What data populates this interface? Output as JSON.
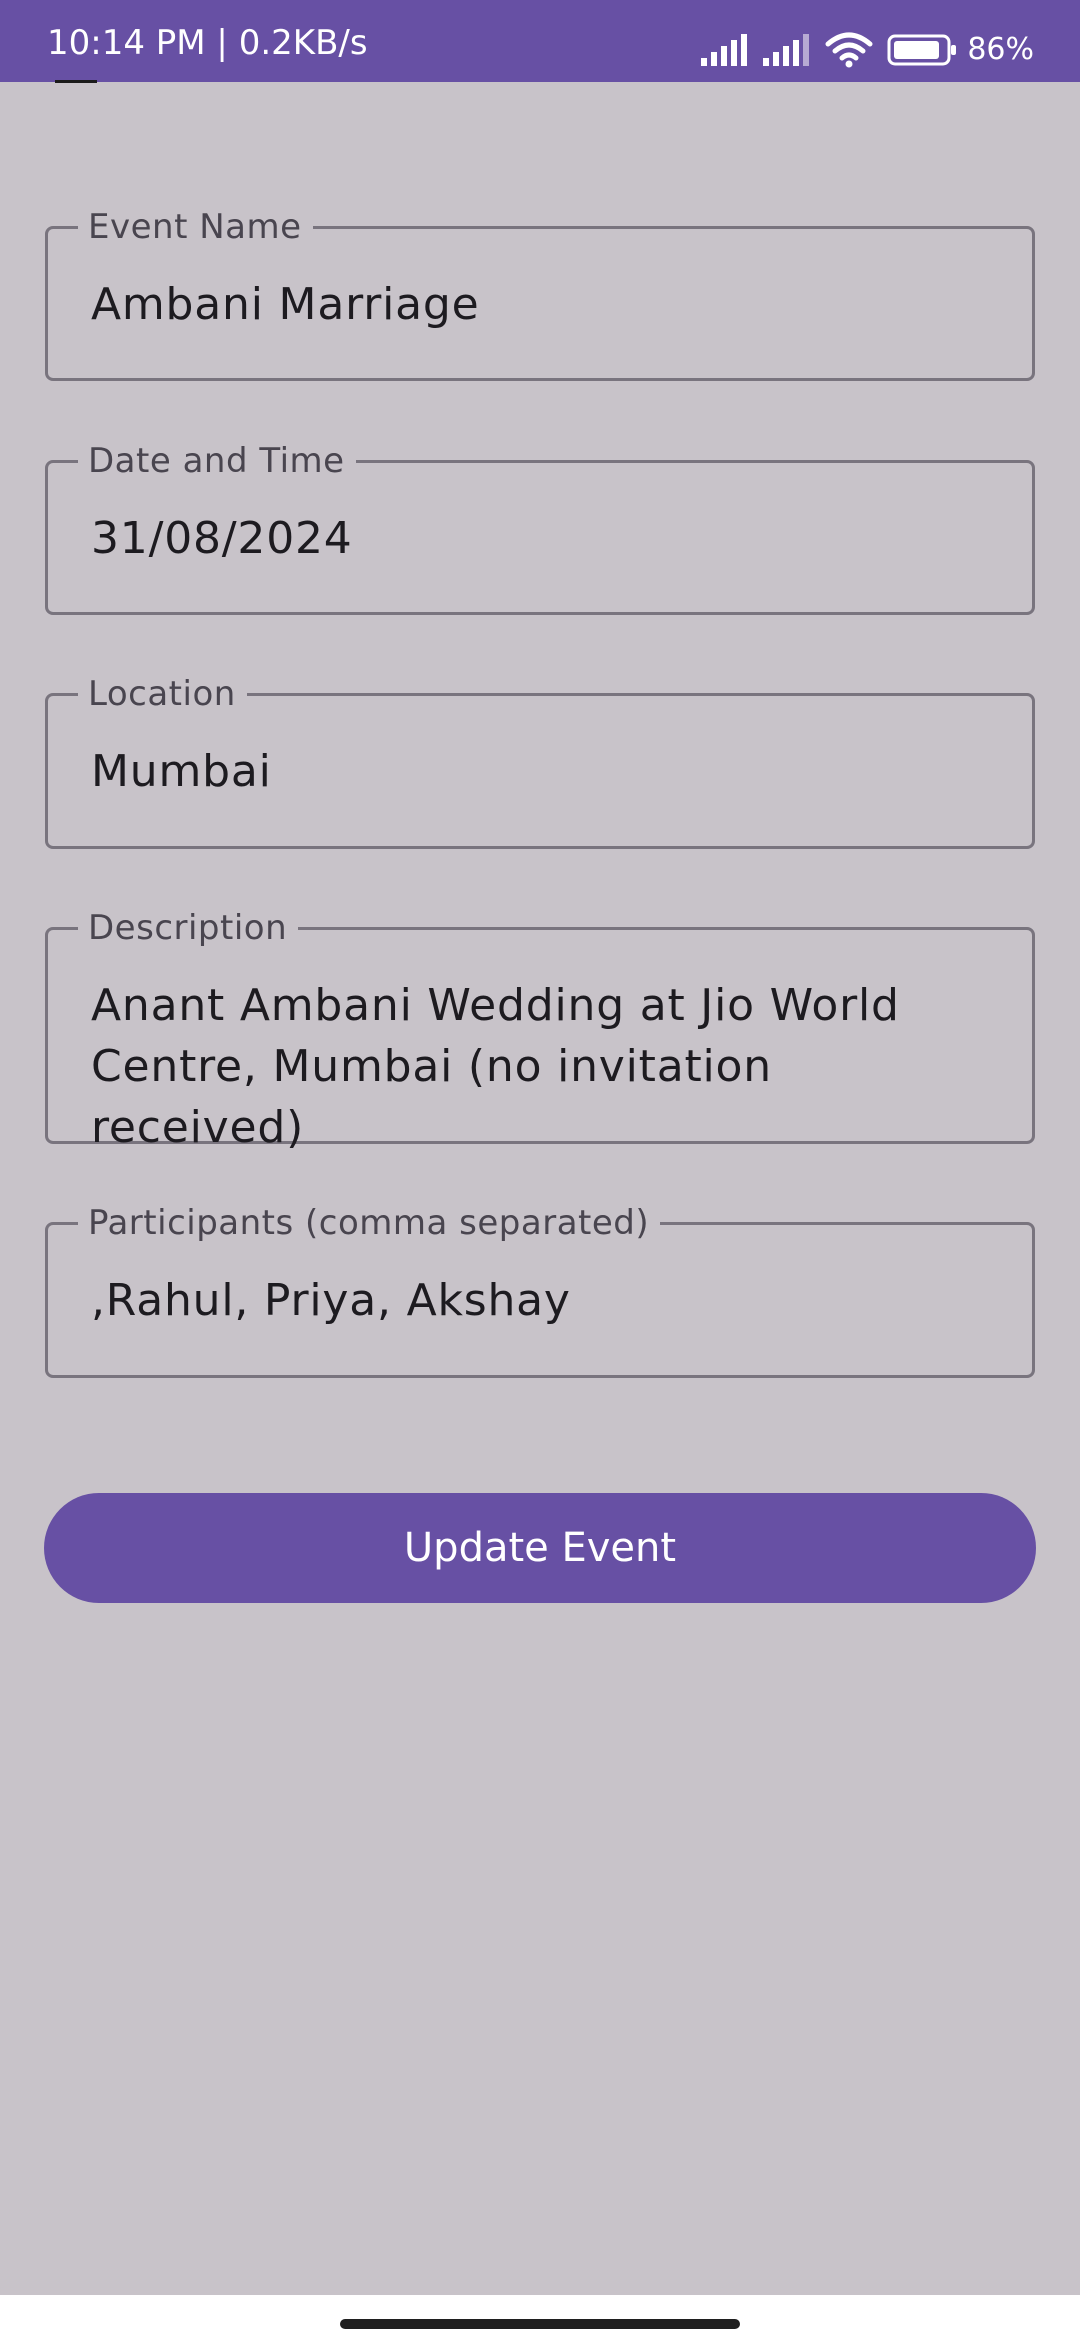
{
  "status_bar": {
    "time_speed": "10:14 PM | 0.2KB/s",
    "battery_percent": "86%",
    "icons": [
      "signal-icon",
      "signal-icon",
      "wifi-icon",
      "battery-icon"
    ]
  },
  "form": {
    "fields": [
      {
        "label": "Event Name",
        "value": "Ambani Marriage"
      },
      {
        "label": "Date and Time",
        "value": "31/08/2024"
      },
      {
        "label": "Location",
        "value": "Mumbai"
      },
      {
        "label": "Description",
        "value": "Anant Ambani Wedding at Jio World Centre, Mumbai (no invitation received)"
      },
      {
        "label": "Participants (comma separated)",
        "value": ",Rahul, Priya, Akshay"
      }
    ],
    "submit_label": "Update Event"
  },
  "colors": {
    "primary": "#6750a4",
    "background": "#c8c3c9",
    "outline": "#79747e",
    "on_surface": "#1d1b20",
    "label": "#49454f"
  }
}
